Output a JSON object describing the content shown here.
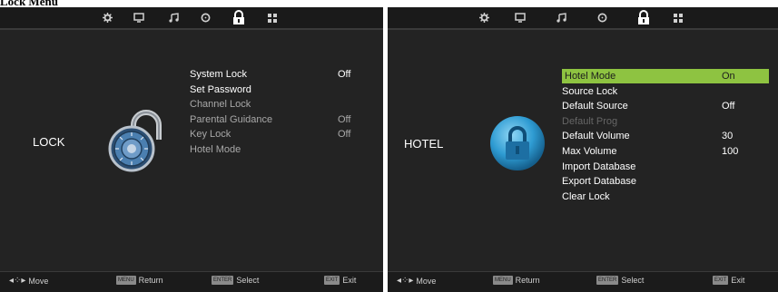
{
  "document_title": "Lock Menu",
  "left_screen": {
    "top_icons": [
      "gear-icon",
      "monitor-icon",
      "music-note-icon",
      "clock-icon",
      "lock-icon",
      "grid-icon"
    ],
    "section_label": "LOCK",
    "menu": [
      {
        "label": "System Lock",
        "value": "Off",
        "state": "active"
      },
      {
        "label": "Set Password",
        "value": "",
        "state": "active"
      },
      {
        "label": "Channel Lock",
        "value": "",
        "state": "inactive"
      },
      {
        "label": "Parental Guidance",
        "value": "Off",
        "state": "inactive"
      },
      {
        "label": "Key Lock",
        "value": "Off",
        "state": "inactive"
      },
      {
        "label": "Hotel Mode",
        "value": "",
        "state": "inactive"
      }
    ],
    "footer": {
      "move": "Move",
      "return_key": "MENU",
      "return": "Return",
      "select_key": "ENTER",
      "select": "Select",
      "exit_key": "EXIT",
      "exit": "Exit"
    }
  },
  "right_screen": {
    "top_icons": [
      "gear-icon",
      "monitor-icon",
      "music-note-icon",
      "clock-icon",
      "lock-icon",
      "grid-icon"
    ],
    "section_label": "HOTEL",
    "menu": [
      {
        "label": "Hotel Mode",
        "value": "On",
        "state": "highlighted"
      },
      {
        "label": "Source Lock",
        "value": "",
        "state": "active"
      },
      {
        "label": "Default Source",
        "value": "Off",
        "state": "active"
      },
      {
        "label": "Default Prog",
        "value": "",
        "state": "disabled"
      },
      {
        "label": "Default Volume",
        "value": "30",
        "state": "active"
      },
      {
        "label": "Max Volume",
        "value": "100",
        "state": "active"
      },
      {
        "label": "Import Database",
        "value": "",
        "state": "active"
      },
      {
        "label": "Export Database",
        "value": "",
        "state": "active"
      },
      {
        "label": "Clear Lock",
        "value": "",
        "state": "active"
      }
    ],
    "footer": {
      "move": "Move",
      "return_key": "MENU",
      "return": "Return",
      "select_key": "ENTER",
      "select": "Select",
      "exit_key": "EXIT",
      "exit": "Exit"
    }
  },
  "colors": {
    "highlight": "#8ec341",
    "background": "#232323",
    "text": "#ffffff",
    "disabled": "#666666"
  }
}
